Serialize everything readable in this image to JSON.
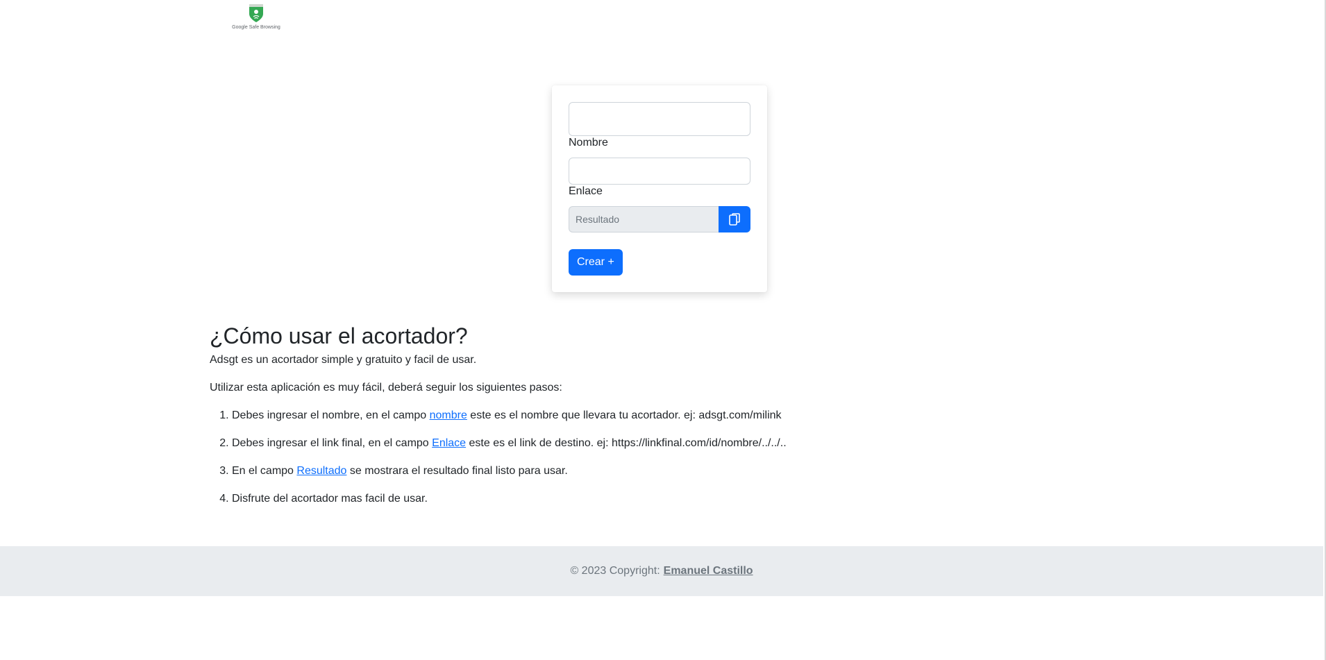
{
  "header": {
    "logo_text": "Google Safe Browsing"
  },
  "form": {
    "nombre_value": "",
    "nombre_label": "Nombre",
    "enlace_value": "",
    "enlace_label": "Enlace",
    "resultado_placeholder": "Resultado",
    "copy_icon": "copy-icon",
    "create_label": "Crear +"
  },
  "instructions": {
    "title": "¿Cómo usar el acortador?",
    "intro": "Adsgt es un acortador simple y gratuito y facil de usar.",
    "lead": "Utilizar esta aplicación es muy fácil, deberá seguir los siguientes pasos:",
    "steps": [
      {
        "before": "Debes ingresar el nombre, en el campo ",
        "link": "nombre",
        "after": " este es el nombre que llevara tu acortador. ej: adsgt.com/milink"
      },
      {
        "before": "Debes ingresar el link final, en el campo ",
        "link": "Enlace",
        "after": " este es el link de destino. ej: https://linkfinal.com/id/nombre/../../.."
      },
      {
        "before": "En el campo ",
        "link": "Resultado",
        "after": " se mostrara el resultado final listo para usar."
      },
      {
        "text": "Disfrute del acortador mas facil de usar."
      }
    ]
  },
  "footer": {
    "copyright": "© 2023 Copyright:",
    "author": "Emanuel Castillo"
  },
  "colors": {
    "primary": "#0d6efd",
    "footer_bg": "#e9ecef",
    "text": "#212529",
    "muted": "#6c757d",
    "shield_green": "#34a853"
  }
}
